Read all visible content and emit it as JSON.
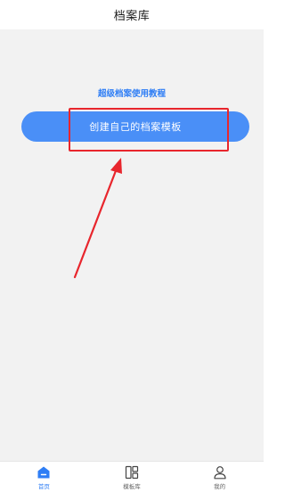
{
  "header": {
    "title": "档案库"
  },
  "main": {
    "tutorial_link": "超级档案使用教程",
    "create_button": "创建自己的档案模板"
  },
  "tabbar": {
    "tabs": [
      {
        "label": "首页",
        "icon": "home-icon",
        "active": true
      },
      {
        "label": "模板库",
        "icon": "template-grid-icon",
        "active": false
      },
      {
        "label": "我的",
        "icon": "user-icon",
        "active": false
      }
    ]
  },
  "colors": {
    "accent": "#2f7ef5",
    "button": "#4a8ff7",
    "annotation": "#e8262d",
    "background": "#f2f2f2"
  }
}
